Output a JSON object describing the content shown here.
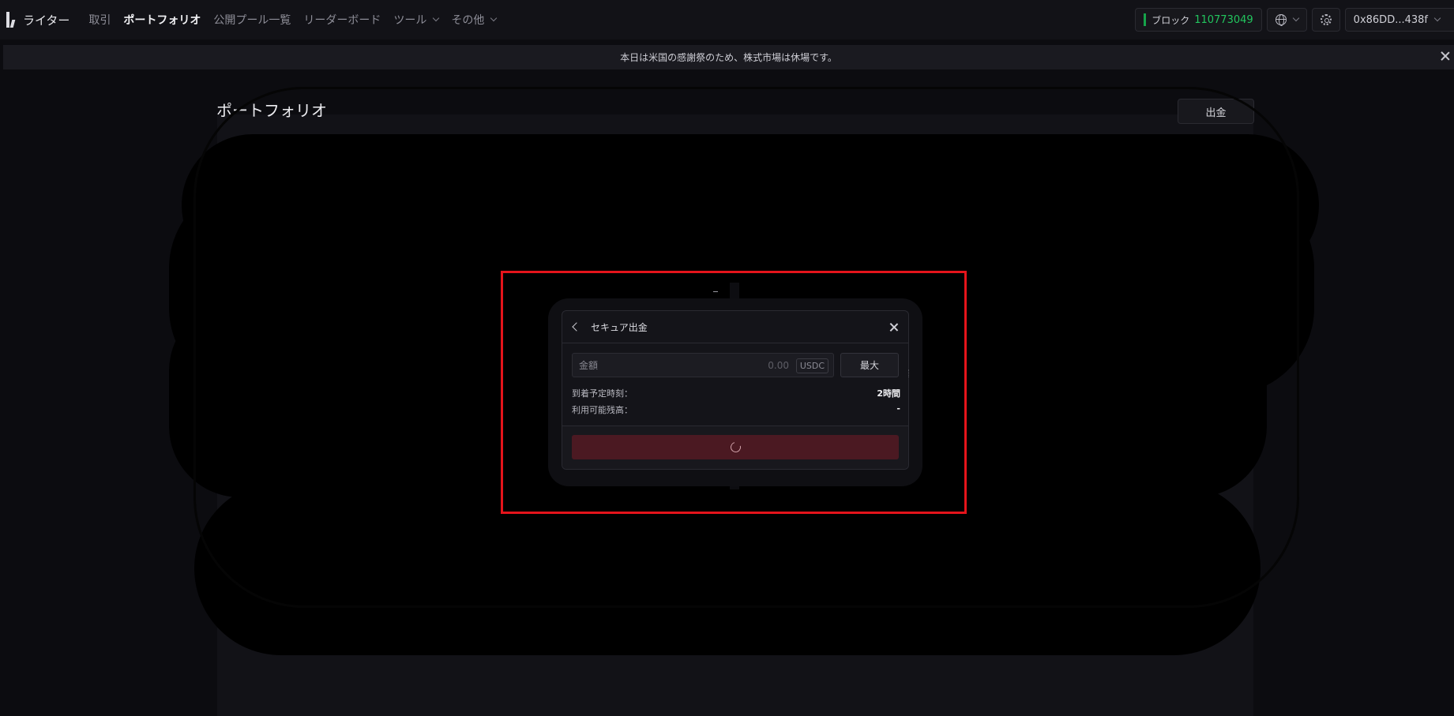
{
  "brand": {
    "name": "ライター"
  },
  "nav": {
    "items": [
      {
        "label": "取引",
        "active": false,
        "dropdown": false
      },
      {
        "label": "ポートフォリオ",
        "active": true,
        "dropdown": false
      },
      {
        "label": "公開プール一覧",
        "active": false,
        "dropdown": false
      },
      {
        "label": "リーダーボード",
        "active": false,
        "dropdown": false
      },
      {
        "label": "ツール",
        "active": false,
        "dropdown": true
      },
      {
        "label": "その他",
        "active": false,
        "dropdown": true
      }
    ]
  },
  "header": {
    "block_label": "ブロック",
    "block_number": "110773049",
    "wallet": "0x86DD...438f",
    "block_color": "#22c55e"
  },
  "announcement": {
    "text": "本日は米国の感謝祭のため、株式市場は休場です。"
  },
  "page": {
    "title": "ポートフォリオ",
    "withdraw_label": "出金"
  },
  "modal": {
    "title": "セキュア出金",
    "amount_label": "金額",
    "amount_placeholder": "0.00",
    "unit": "USDC",
    "max_label": "最大",
    "eta_label": "到着予定時刻：",
    "eta_value": "2時間",
    "available_label": "利用可能残高：",
    "available_value": "-",
    "submit_state": "loading",
    "submit_color": "#4b1922"
  },
  "overlay": {
    "dash": "-",
    "highlight_color": "#e5141b"
  }
}
